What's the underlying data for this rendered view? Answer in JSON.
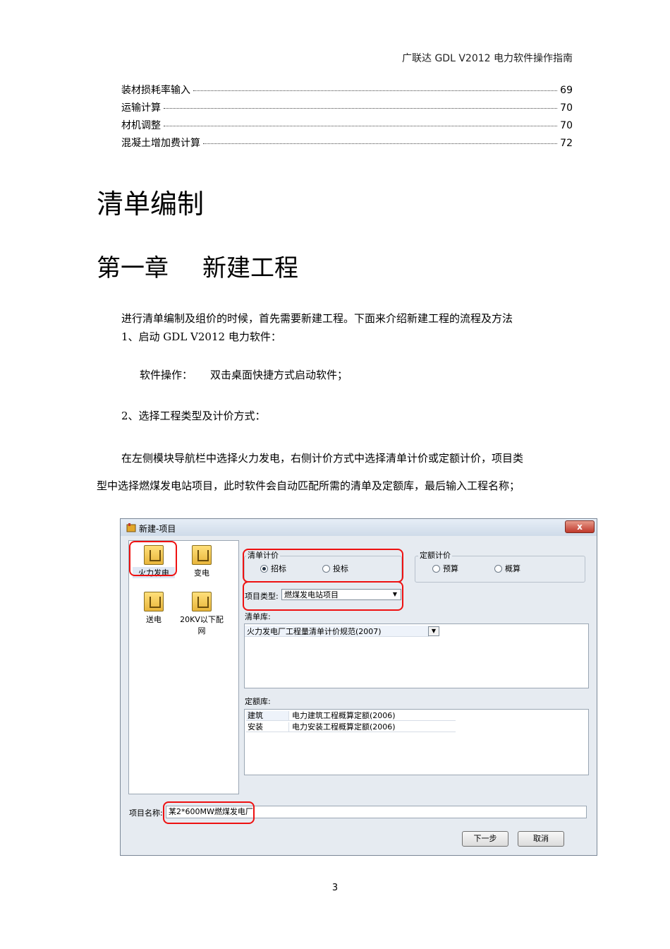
{
  "header": "广联达 GDL V2012 电力软件操作指南",
  "toc": [
    {
      "title": "装材损耗率输入",
      "page": "69"
    },
    {
      "title": "运输计算",
      "page": "70"
    },
    {
      "title": "材机调整",
      "page": "70"
    },
    {
      "title": "混凝土增加费计算",
      "page": "72"
    }
  ],
  "heading1": "清单编制",
  "heading2_num": "第一章",
  "heading2_title": "新建工程",
  "paragraphs": {
    "p1": "进行清单编制及组价的时候，首先需要新建工程。下面来介绍新建工程的流程及方法",
    "p2": "1、启动 GDL V2012 电力软件：",
    "p3_label": "软件操作：",
    "p3_text": "双击桌面快捷方式启动软件；",
    "p4": "2、选择工程类型及计价方式：",
    "p5_line1": "在左侧模块导航栏中选择火力发电，右侧计价方式中选择清单计价或定额计价，项目类",
    "p5_line2": "型中选择燃煤发电站项目，此时软件会自动匹配所需的清单及定额库，最后输入工程名称；"
  },
  "dialog": {
    "title": "新建-项目",
    "close": "x",
    "modules": [
      "火力发电",
      "变电",
      "送电",
      "20KV以下配网"
    ],
    "qd_group": {
      "title": "清单计价",
      "options": [
        "招标",
        "投标"
      ],
      "selected": "招标"
    },
    "de_group": {
      "title": "定额计价",
      "options": [
        "预算",
        "概算"
      ]
    },
    "project_type_label": "项目类型:",
    "project_type_value": "燃煤发电站项目",
    "qd_lib_label": "清单库:",
    "qd_lib_value": "火力发电厂工程量清单计价规范(2007)",
    "de_lib_label": "定额库:",
    "de_lib_rows": [
      {
        "type": "建筑",
        "name": "电力建筑工程概算定额(2006)"
      },
      {
        "type": "安装",
        "name": "电力安装工程概算定额(2006)"
      }
    ],
    "project_name_label": "项目名称:",
    "project_name_value": "某2*600MW燃煤发电厂",
    "next_button": "下一步",
    "cancel_button": "取消"
  },
  "page_number": "3"
}
